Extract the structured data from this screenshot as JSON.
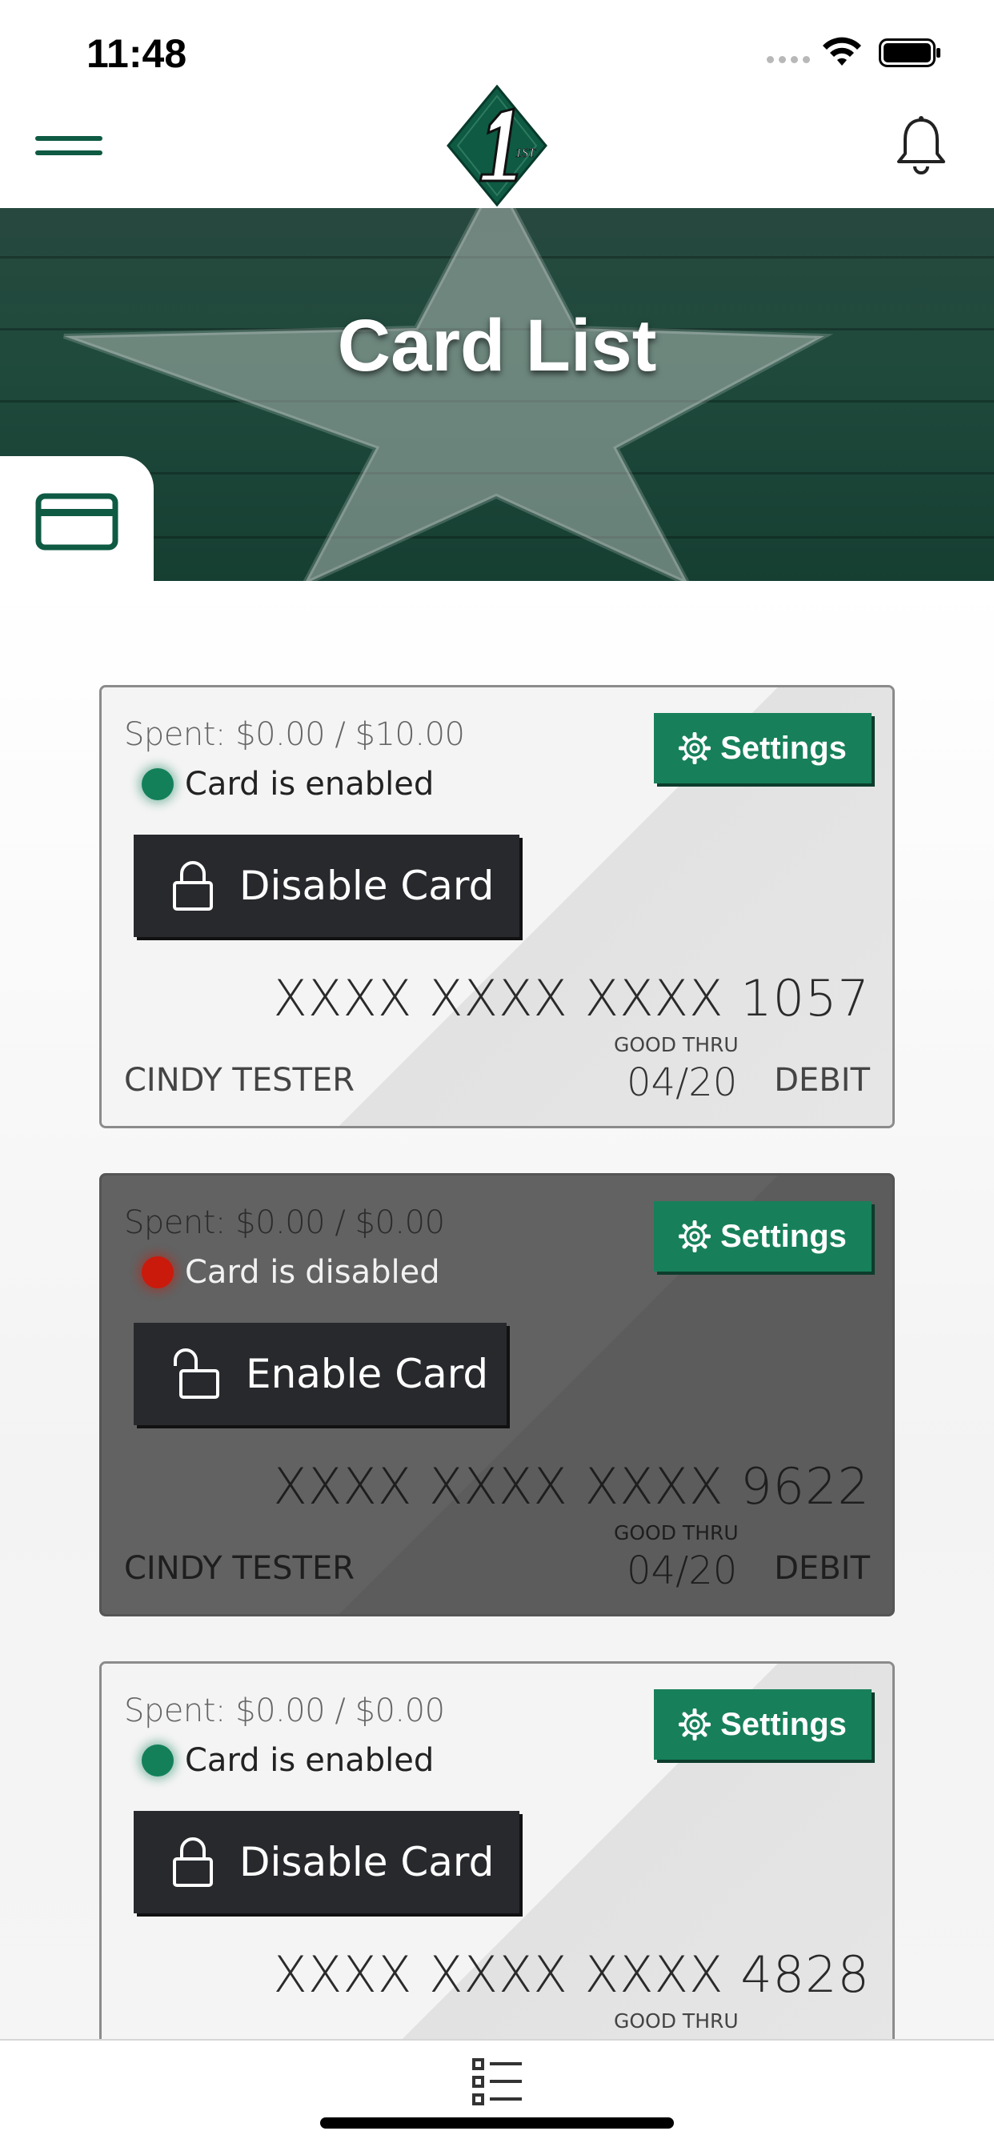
{
  "status_bar": {
    "time": "11:48",
    "icons": [
      "cellular-signal-icon",
      "wifi-icon",
      "battery-icon"
    ]
  },
  "header": {
    "menu_icon": "hamburger-menu-icon",
    "logo_text": "1ST",
    "notification_icon": "bell-icon"
  },
  "hero": {
    "title": "Card List",
    "tab_icon": "credit-card-icon"
  },
  "colors": {
    "brand_green": "#17805a",
    "dark_green": "#0e5a43",
    "enabled_dot": "#13805a",
    "disabled_dot": "#c91a0c",
    "button_dark": "#27292d"
  },
  "cards": [
    {
      "spent": "Spent: $0.00 / $10.00",
      "status_prefix": "Card is",
      "status_word": "enabled",
      "toggle_label": "Disable Card",
      "settings_label": "Settings",
      "number": "XXXX XXXX XXXX 1057",
      "holder": "CINDY TESTER",
      "good_thru_label": "GOOD THRU",
      "expiry": "04/20",
      "type": "DEBIT"
    },
    {
      "spent": "Spent: $0.00 / $0.00",
      "status_prefix": "Card is",
      "status_word": "disabled",
      "toggle_label": "Enable Card",
      "settings_label": "Settings",
      "number": "XXXX XXXX XXXX 9622",
      "holder": "CINDY TESTER",
      "good_thru_label": "GOOD THRU",
      "expiry": "04/20",
      "type": "DEBIT"
    },
    {
      "spent": "Spent: $0.00 / $0.00",
      "status_prefix": "Card is",
      "status_word": "enabled",
      "toggle_label": "Disable Card",
      "settings_label": "Settings",
      "number": "XXXX XXXX XXXX 4828",
      "good_thru_label": "GOOD THRU"
    }
  ],
  "tab_bar": {
    "icon": "list-icon"
  }
}
